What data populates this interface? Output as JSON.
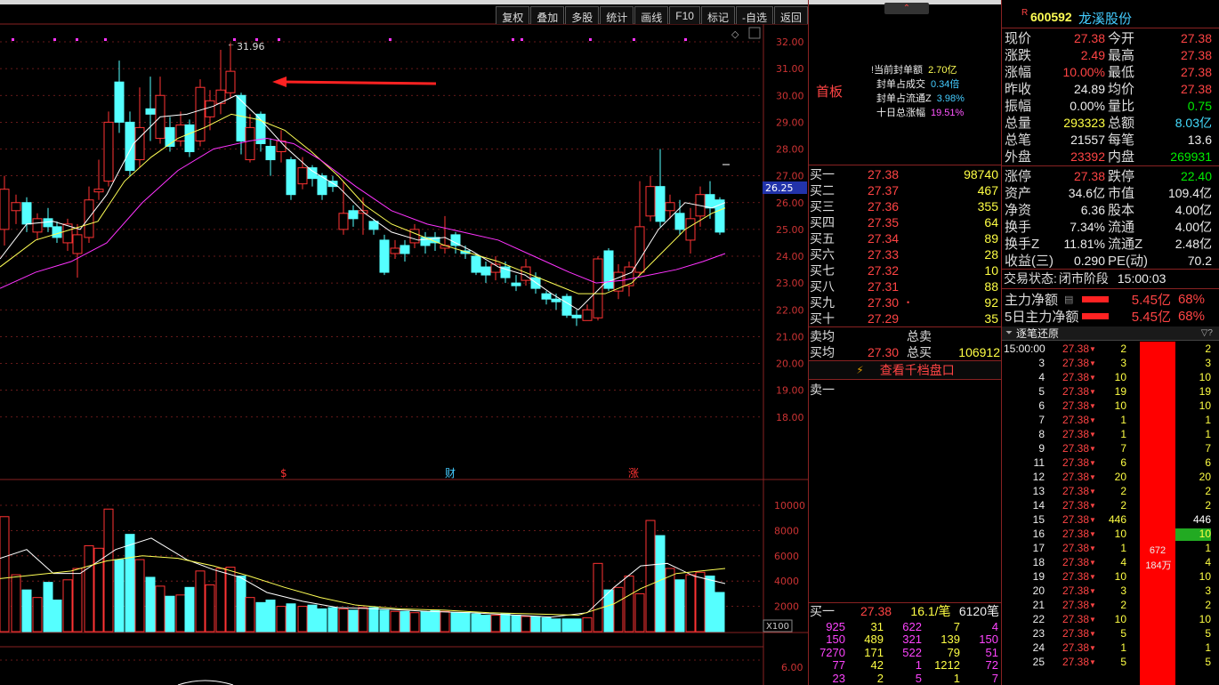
{
  "toolbar": {
    "items": [
      "复权",
      "叠加",
      "多股",
      "统计",
      "画线",
      "F10",
      "标记",
      "-自选",
      "返回"
    ]
  },
  "chart": {
    "price_axis": [
      "32.00",
      "31.00",
      "30.00",
      "29.00",
      "28.00",
      "27.00",
      "26.00",
      "25.00",
      "24.00",
      "23.00",
      "22.00",
      "21.00",
      "20.00",
      "19.00",
      "18.00"
    ],
    "current_price_tag": "26.25",
    "high_marker": "31.96",
    "event_markers": [
      "$",
      "财",
      "涨"
    ],
    "volume_axis": [
      "10000",
      "8000",
      "6000",
      "4000",
      "2000"
    ],
    "volume_unit": "X100",
    "lower_axis": "6.00"
  },
  "seal": {
    "label": "首板",
    "lines": [
      {
        "k": "当前封单额",
        "v": "2.70亿"
      },
      {
        "k": "封单占成交",
        "v": "0.34倍"
      },
      {
        "k": "封单占流通Z",
        "v": "3.98%"
      },
      {
        "k": "十日总涨幅",
        "v": "19.51%"
      }
    ]
  },
  "bids": [
    {
      "n": "买一",
      "p": "27.38",
      "v": "98740"
    },
    {
      "n": "买二",
      "p": "27.37",
      "v": "467"
    },
    {
      "n": "买三",
      "p": "27.36",
      "v": "355"
    },
    {
      "n": "买四",
      "p": "27.35",
      "v": "64"
    },
    {
      "n": "买五",
      "p": "27.34",
      "v": "89"
    },
    {
      "n": "买六",
      "p": "27.33",
      "v": "28"
    },
    {
      "n": "买七",
      "p": "27.32",
      "v": "10"
    },
    {
      "n": "买八",
      "p": "27.31",
      "v": "88"
    },
    {
      "n": "买九",
      "p": "27.30",
      "v": "92"
    },
    {
      "n": "买十",
      "p": "27.29",
      "v": "35"
    }
  ],
  "avg": {
    "sell_label": "卖均",
    "total_sell_label": "总卖",
    "buy_label": "买均",
    "buy_avg": "27.30",
    "total_buy_label": "总买",
    "total_buy": "106912"
  },
  "view_btn": "查看千档盘口",
  "sell1": "卖一",
  "queue": {
    "head": {
      "n": "买一",
      "p": "27.38",
      "avg": "16.1/笔",
      "cnt": "6120笔"
    },
    "rows": [
      [
        "925",
        "31",
        "622",
        "7",
        "4"
      ],
      [
        "150",
        "489",
        "321",
        "139",
        "150"
      ],
      [
        "7270",
        "171",
        "522",
        "79",
        "51"
      ],
      [
        "77",
        "42",
        "1",
        "1212",
        "72"
      ],
      [
        "23",
        "2",
        "5",
        "1",
        "7"
      ]
    ]
  },
  "stock": {
    "flag": "R",
    "code": "600592",
    "name": "龙溪股份"
  },
  "quote": [
    [
      "现价",
      "27.38",
      "今开",
      "27.38"
    ],
    [
      "涨跌",
      "2.49",
      "最高",
      "27.38"
    ],
    [
      "涨幅",
      "10.00%",
      "最低",
      "27.38"
    ],
    [
      "昨收",
      "24.89",
      "均价",
      "27.38"
    ],
    [
      "振幅",
      "0.00%",
      "量比",
      "0.75"
    ],
    [
      "总量",
      "293323",
      "总额",
      "8.03亿"
    ],
    [
      "总笔",
      "21557",
      "每笔",
      "13.6"
    ],
    [
      "外盘",
      "23392",
      "内盘",
      "269931"
    ]
  ],
  "fund": [
    [
      "涨停",
      "27.38",
      "跌停",
      "22.40"
    ],
    [
      "资产",
      "34.6亿",
      "市值",
      "109.4亿"
    ],
    [
      "净资",
      "6.36",
      "股本",
      "4.00亿"
    ],
    [
      "换手",
      "7.34%",
      "流通",
      "4.00亿"
    ],
    [
      "换手Z",
      "11.81%",
      "流通Z",
      "2.48亿"
    ],
    [
      "收益(三)",
      "0.290",
      "PE(动)",
      "70.2"
    ]
  ],
  "status": {
    "label": "交易状态:",
    "value": "闭市阶段",
    "time": "15:00:03"
  },
  "capital": [
    {
      "k": "主力净额",
      "v": "5.45亿",
      "pct": "68%"
    },
    {
      "k": "5日主力净额",
      "v": "5.45亿",
      "pct": "68%"
    }
  ],
  "ticks": {
    "title": "逐笔还原",
    "first_time": "15:00:00",
    "rows": [
      [
        "",
        "27.38",
        "2",
        "2"
      ],
      [
        "3",
        "27.38",
        "3",
        "3"
      ],
      [
        "4",
        "27.38",
        "10",
        "10"
      ],
      [
        "5",
        "27.38",
        "19",
        "19"
      ],
      [
        "6",
        "27.38",
        "10",
        "10"
      ],
      [
        "7",
        "27.38",
        "1",
        "1"
      ],
      [
        "8",
        "27.38",
        "1",
        "1"
      ],
      [
        "9",
        "27.38",
        "7",
        "7"
      ],
      [
        "11",
        "27.38",
        "6",
        "6"
      ],
      [
        "12",
        "27.38",
        "20",
        "20"
      ],
      [
        "13",
        "27.38",
        "2",
        "2"
      ],
      [
        "14",
        "27.38",
        "2",
        "2"
      ],
      [
        "15",
        "27.38",
        "446",
        "446"
      ],
      [
        "16",
        "27.38",
        "10",
        "10"
      ],
      [
        "17",
        "27.38",
        "1",
        "1"
      ],
      [
        "18",
        "27.38",
        "4",
        "4"
      ],
      [
        "19",
        "27.38",
        "10",
        "10"
      ],
      [
        "20",
        "27.38",
        "3",
        "3"
      ],
      [
        "21",
        "27.38",
        "2",
        "2"
      ],
      [
        "22",
        "27.38",
        "10",
        "10"
      ],
      [
        "23",
        "27.38",
        "5",
        "5"
      ],
      [
        "24",
        "27.38",
        "1",
        "1"
      ],
      [
        "25",
        "27.38",
        "5",
        "5"
      ]
    ],
    "bar_total": "672",
    "bar_amount": "184万"
  },
  "colors": {
    "up": "#ff3333",
    "down": "#55ffff",
    "ma5": "#ffffff",
    "ma10": "#ffff55",
    "ma20": "#ff33ff",
    "grid": "#882222"
  }
}
